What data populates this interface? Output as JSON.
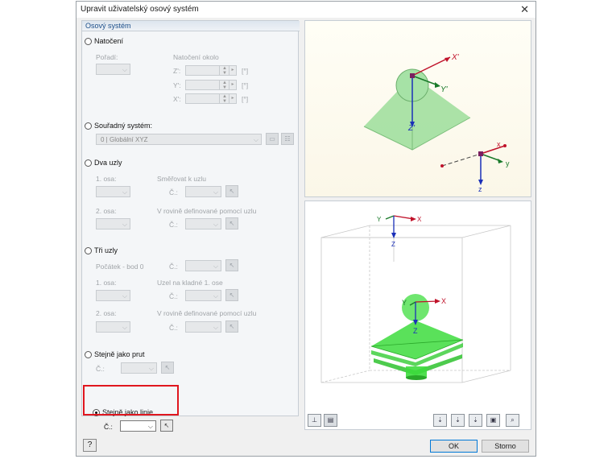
{
  "window": {
    "title": "Upravit uživatelský osový systém",
    "close_glyph": "✕"
  },
  "panel": {
    "title": "Osový systém"
  },
  "natoceni": {
    "radio_label": "Natočení",
    "poradi_label": "Pořadí:",
    "natoceni_okolo_label": "Natočení okolo",
    "axis_z": "Z':",
    "axis_y": "Y':",
    "axis_x": "X':",
    "unit": "[°]"
  },
  "souradny": {
    "radio_label": "Souřadný systém:",
    "value": "0 | Globální XYZ"
  },
  "dva_uzly": {
    "radio_label": "Dva uzly",
    "osa1_label": "1. osa:",
    "smerovat_label": "Směřovat k uzlu",
    "c_label": "Č.:",
    "osa2_label": "2. osa:",
    "rovina_label": "V rovině definované pomocí uzlu",
    "c2_label": "Č.:"
  },
  "tri_uzly": {
    "radio_label": "Tři uzly",
    "pocatek_label": "Počátek - bod 0",
    "c_label": "Č.:",
    "osa1_label": "1. osa:",
    "uzel_label": "Uzel na kladné 1. ose",
    "c2_label": "Č.:",
    "osa2_label": "2. osa:",
    "rovina_label": "V rovině definované pomocí uzlu",
    "c3_label": "Č.:"
  },
  "prut": {
    "radio_label": "Stejně jako prut",
    "c_label": "Č.:"
  },
  "linie": {
    "radio_label": "Stejně jako linie",
    "c_label": "Č.:"
  },
  "preview_top": {
    "labels": {
      "x": "X'",
      "y": "Y'",
      "z": "Z'",
      "x2": "x",
      "y2": "y",
      "z2": "z"
    }
  },
  "preview_bottom": {
    "labels": {
      "y": "Y",
      "x": "X",
      "z": "Z",
      "y2": "Y",
      "x2": "X",
      "z2": "Z"
    }
  },
  "buttons": {
    "ok": "OK",
    "cancel": "Storno",
    "help": "?"
  },
  "colors": {
    "accent_red": "#e0161e",
    "axis_red": "#c0122a",
    "axis_green": "#1a7a2a",
    "axis_blue": "#1a2fb8",
    "shape_green": "#33dd33"
  }
}
